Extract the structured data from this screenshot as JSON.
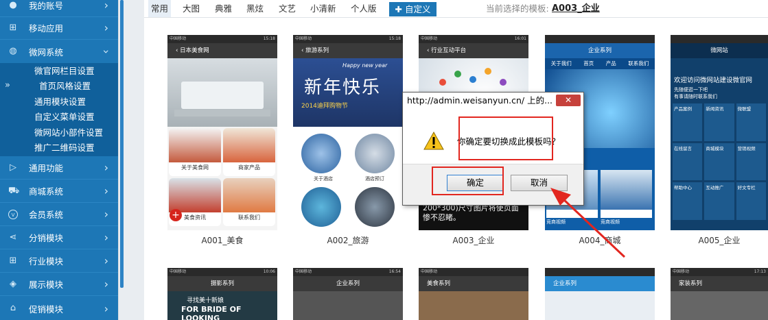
{
  "sidebar": {
    "items": [
      {
        "label": "我的账号",
        "icon": "user-icon"
      },
      {
        "label": "移动应用",
        "icon": "grid-icon"
      },
      {
        "label": "微网系统",
        "icon": "globe-icon"
      },
      {
        "label": "通用功能",
        "icon": "play-icon"
      },
      {
        "label": "商城系统",
        "icon": "cart-icon"
      },
      {
        "label": "会员系统",
        "icon": "vip-icon"
      },
      {
        "label": "分销模块",
        "icon": "share-icon"
      },
      {
        "label": "行业模块",
        "icon": "apps-icon"
      },
      {
        "label": "展示模块",
        "icon": "gamepad-icon"
      },
      {
        "label": "促销模块",
        "icon": "store-icon"
      }
    ],
    "subitems": [
      "微官网栏目设置",
      "首页风格设置",
      "通用模块设置",
      "自定义菜单设置",
      "微网站小部件设置",
      "推广二维码设置"
    ],
    "expand_glyph": "»",
    "chevron": "›"
  },
  "tabs": [
    "常用",
    "大图",
    "典雅",
    "黑炫",
    "文艺",
    "小清新",
    "个人版"
  ],
  "custom_tab": "自定义",
  "current": {
    "label": "当前选择的模板:",
    "value": "A003_企业"
  },
  "templates": [
    {
      "caption": "A001_美食",
      "title": "日本美食网",
      "items": [
        "关于美食网",
        "商家产品",
        "美食资讯",
        "联系我们"
      ]
    },
    {
      "caption": "A002_旅游",
      "title": "旅游系列",
      "banner1": "Happy new year",
      "banner2": "新年快乐",
      "banner3": "2014迪拜购物节",
      "items": [
        "关于酒店",
        "酒店预订"
      ]
    },
    {
      "caption": "A003_企业",
      "title": "行业互动平台",
      "overlay": "网图片，使用此尺寸以面的(如200*300)尺寸图片将使页面惨不忍睹。"
    },
    {
      "caption": "A004_商城",
      "title": "企业系列",
      "nav": [
        "关于我们",
        "首页",
        "产品",
        "联系我们"
      ],
      "items": [
        "企业新闻",
        "竞商视频",
        "竞商视频",
        "竞商工作"
      ]
    },
    {
      "caption": "A005_企业",
      "title": "微网站",
      "welcome": "欢迎访问微网站建设微官网",
      "sub": "先随便逛一下吧",
      "sub2": "有事请随时联系我们",
      "items": [
        "产品案例",
        "新闻资讯",
        "微联盟",
        "在线留言",
        "商城模块",
        "营销视频",
        "帮助中心",
        "互动推广",
        "好文专栏"
      ],
      "foot": [
        "电话",
        "地址",
        "会员卡"
      ]
    }
  ],
  "row2": [
    "摄影系列",
    "企业系列",
    "美食系列",
    "企业系列",
    "家装系列"
  ],
  "row2_banner": "寻找美十新娘",
  "row2_banner2": "FOR BRIDE OF LOOKING",
  "phone_status": [
    "中国移动",
    "0.07K/s",
    "15:18",
    "0.00K/s",
    "15:18",
    "16:01",
    "16:54",
    "10:06",
    "17:13"
  ],
  "dialog": {
    "title": "http://admin.weisanyun.cn/ 上的...",
    "message": "你确定要切换成此模板吗？",
    "ok": "确定",
    "cancel": "取消",
    "close": "✕"
  },
  "colors": {
    "sidebar": "#1d77b6",
    "subnav": "#10609b",
    "accent": "#1d77b6",
    "highlight": "#e2261f"
  }
}
